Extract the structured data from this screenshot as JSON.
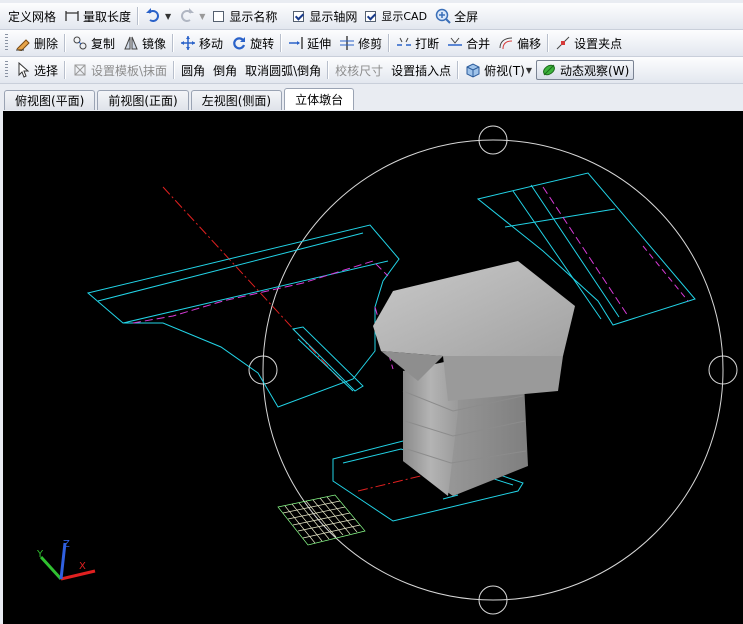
{
  "toolbar_row1": {
    "define_grid": "定义网格",
    "measure_length": "量取长度",
    "show_name": "显示名称",
    "show_axis": "显示轴网",
    "show_cad": "显示CAD",
    "fullscreen": "全屏"
  },
  "toolbar_row2": {
    "delete": "删除",
    "copy": "复制",
    "mirror": "镜像",
    "move": "移动",
    "rotate": "旋转",
    "extend": "延伸",
    "trim": "修剪",
    "break": "打断",
    "merge": "合并",
    "offset": "偏移",
    "set_grip": "设置夹点"
  },
  "toolbar_row3": {
    "select": "选择",
    "set_template": "设置模板\\抹面",
    "round_corner": "圆角",
    "chamfer": "倒角",
    "cancel_arc": "取消圆弧\\倒角",
    "check_edge": "校核尺寸",
    "set_insert_point": "设置插入点",
    "top_view": "俯视(T)",
    "dynamic_view": "动态观察(W)"
  },
  "view_tabs": [
    {
      "label": "俯视图(平面)",
      "active": false
    },
    {
      "label": "前视图(正面)",
      "active": false
    },
    {
      "label": "左视图(侧面)",
      "active": false
    },
    {
      "label": "立体墩台",
      "active": true
    }
  ],
  "checkboxes": {
    "show_name": false,
    "show_axis": true,
    "show_cad": true
  },
  "colors": {
    "viewport_bg": "#000000",
    "cyan_line": "#22d3e6",
    "magenta_line": "#d63ad6",
    "red_axis": "#e02020",
    "orbit_circle": "#d8d8d8",
    "solid_gray": "#a8a8a8"
  },
  "axis_labels": {
    "x": "X",
    "y": "Y",
    "z": "Z"
  }
}
